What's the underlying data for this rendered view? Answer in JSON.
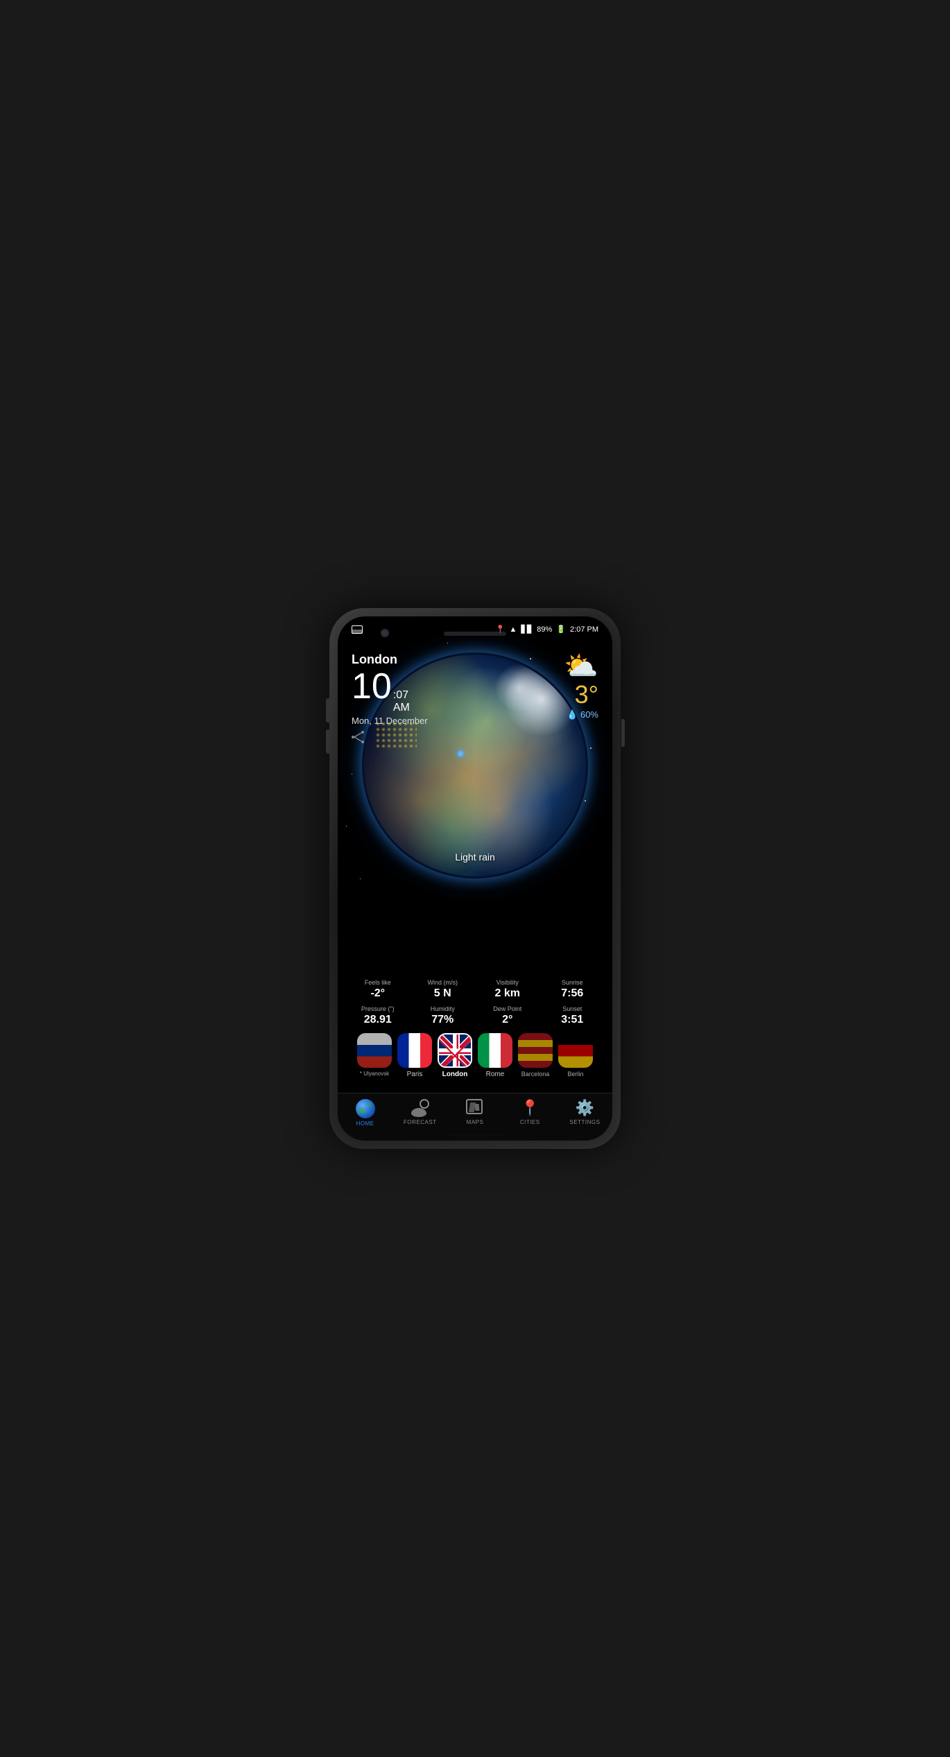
{
  "phone": {
    "status_bar": {
      "location_icon": "📍",
      "wifi_icon": "wifi",
      "signal_icon": "signal",
      "battery": "89%",
      "time": "2:07 PM"
    },
    "city": "London",
    "time_hour": "10",
    "time_minute": ":07",
    "time_ampm": "AM",
    "date": "Mon, 11 December",
    "weather": {
      "condition": "Light rain",
      "temperature": "3°",
      "humidity": "60%",
      "feels_like_label": "Feels like",
      "feels_like": "-2°",
      "wind_label": "Wind (m/s)",
      "wind": "5 N",
      "visibility_label": "Visibility",
      "visibility": "2 km",
      "sunrise_label": "Sunrise",
      "sunrise": "7:56",
      "pressure_label": "Pressure (\")",
      "pressure": "28.91",
      "humidity_label": "Humidity",
      "humidity_pct": "77%",
      "dew_point_label": "Dew Point",
      "dew_point": "2°",
      "sunset_label": "Sunset",
      "sunset": "3:51"
    },
    "cities": [
      {
        "name": "Ulyanovsk",
        "flag": "ru",
        "label": "* Ulyanovsk",
        "active": false
      },
      {
        "name": "Paris",
        "flag": "fr",
        "label": "Paris",
        "active": false
      },
      {
        "name": "London",
        "flag": "uk",
        "label": "London",
        "active": true
      },
      {
        "name": "Rome",
        "flag": "it",
        "label": "Rome",
        "active": false
      },
      {
        "name": "Barcelona",
        "flag": "es",
        "label": "Barcelona",
        "active": false
      },
      {
        "name": "Berlin",
        "flag": "de",
        "label": "Berlin",
        "active": false
      }
    ],
    "nav": {
      "home": {
        "label": "HOME",
        "active": true
      },
      "forecast": {
        "label": "FORECAST",
        "active": false
      },
      "maps": {
        "label": "MAPS",
        "active": false
      },
      "cities": {
        "label": "CITIES",
        "active": false
      },
      "settings": {
        "label": "SETTINGS",
        "active": false
      }
    }
  }
}
